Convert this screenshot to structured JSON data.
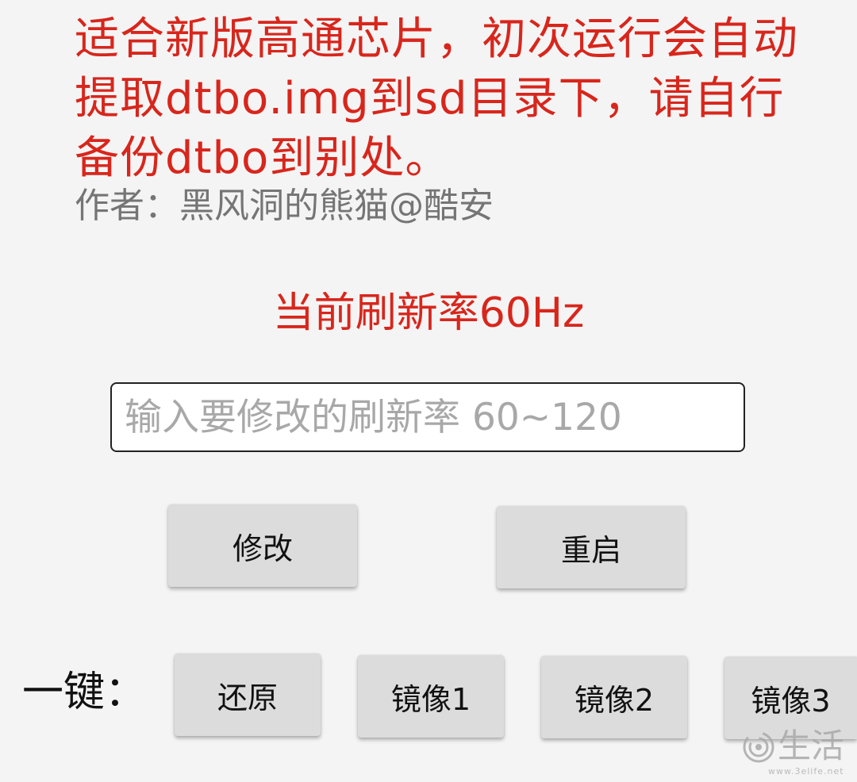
{
  "header": {
    "notice": "适合新版高通芯片，初次运行会自动提取dtbo.img到sd目录下，请自行备份dtbo到别处。",
    "author": "作者：黑风洞的熊猫@酷安"
  },
  "status": {
    "current_rate_text": "当前刷新率60Hz"
  },
  "form": {
    "rate_input_value": "",
    "rate_input_placeholder": "输入要修改的刷新率 60~120"
  },
  "actions": {
    "modify_label": "修改",
    "reboot_label": "重启"
  },
  "one_key": {
    "label": "一键：",
    "buttons": [
      {
        "label": "还原"
      },
      {
        "label": "镜像1"
      },
      {
        "label": "镜像2"
      },
      {
        "label": "镜像3"
      }
    ]
  },
  "watermark": {
    "text": "生活",
    "url": "www.3elife.net",
    "icon": "swirl-logo-icon"
  },
  "colors": {
    "background": "#f4f4f4",
    "accent_red": "#d8261c",
    "author_gray": "#757575",
    "button_gray": "#dcdcdc",
    "placeholder_gray": "#a8a8a8"
  }
}
